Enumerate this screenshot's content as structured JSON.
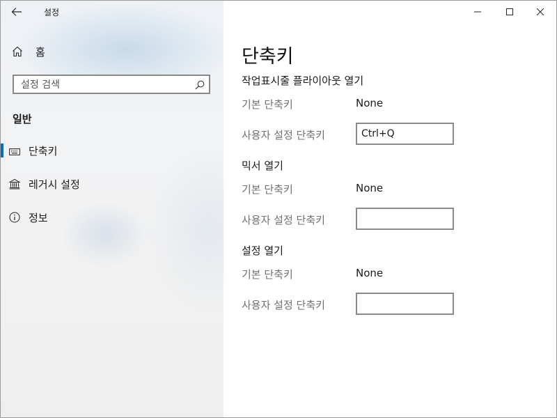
{
  "window": {
    "app_title": "설정"
  },
  "sidebar": {
    "home_label": "홈",
    "search_placeholder": "설정 검색",
    "section_label": "일반",
    "items": [
      {
        "label": "단축키",
        "icon": "keyboard-icon",
        "active": true
      },
      {
        "label": "레거시 설정",
        "icon": "bank-icon",
        "active": false
      },
      {
        "label": "정보",
        "icon": "info-icon",
        "active": false
      }
    ]
  },
  "content": {
    "title": "단축키",
    "groups": [
      {
        "title": "작업표시줄 플라이아웃 열기",
        "default_label": "기본 단축키",
        "default_value": "None",
        "custom_label": "사용자 설정 단축키",
        "custom_value": "Ctrl+Q"
      },
      {
        "title": "믹서 열기",
        "default_label": "기본 단축키",
        "default_value": "None",
        "custom_label": "사용자 설정 단축키",
        "custom_value": ""
      },
      {
        "title": "설정 열기",
        "default_label": "기본 단축키",
        "default_value": "None",
        "custom_label": "사용자 설정 단축키",
        "custom_value": ""
      }
    ]
  },
  "colors": {
    "accent": "#0a6cc7",
    "secondary_text": "#707070"
  }
}
